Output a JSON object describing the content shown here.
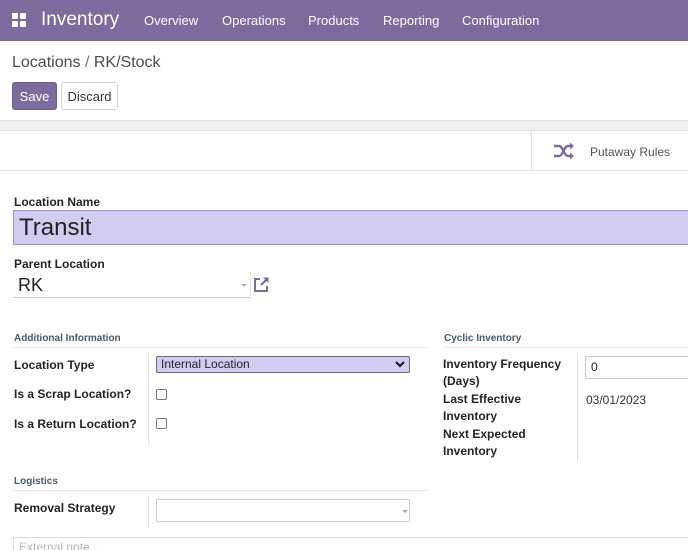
{
  "navbar": {
    "app_name": "Inventory",
    "menu": [
      "Overview",
      "Operations",
      "Products",
      "Reporting",
      "Configuration"
    ],
    "colors": {
      "bg": "#7c6c9e"
    }
  },
  "control_panel": {
    "breadcrumb": {
      "parent": "Locations",
      "separator": "/",
      "current": "RK/Stock"
    },
    "save_label": "Save",
    "discard_label": "Discard"
  },
  "button_box": {
    "putaway_label": "Putaway Rules",
    "putaway_icon": "shuffle-icon"
  },
  "form": {
    "location_name_label": "Location Name",
    "location_name_value": "Transit",
    "parent_location_label": "Parent Location",
    "parent_location_value": "RK",
    "external_link_icon": "external-link-icon"
  },
  "additional_info": {
    "title": "Additional Information",
    "location_type_label": "Location Type",
    "location_type_value": "Internal Location",
    "scrap_label": "Is a Scrap Location?",
    "scrap_checked": false,
    "return_label": "Is a Return Location?",
    "return_checked": false
  },
  "cyclic_inventory": {
    "title": "Cyclic Inventory",
    "frequency_label_line1": "Inventory Frequency",
    "frequency_label_line2": "(Days)",
    "frequency_value": "0",
    "last_effective_line1": "Last Effective",
    "last_effective_line2": "Inventory",
    "last_effective_value": "03/01/2023",
    "next_expected_line1": "Next Expected",
    "next_expected_line2": "Inventory"
  },
  "logistics": {
    "title": "Logistics",
    "removal_strategy_label": "Removal Strategy",
    "removal_strategy_value": ""
  },
  "note": {
    "placeholder": "External note..."
  },
  "colors": {
    "accent": "#7c6c9e",
    "input_highlight": "#d2ccf2"
  }
}
